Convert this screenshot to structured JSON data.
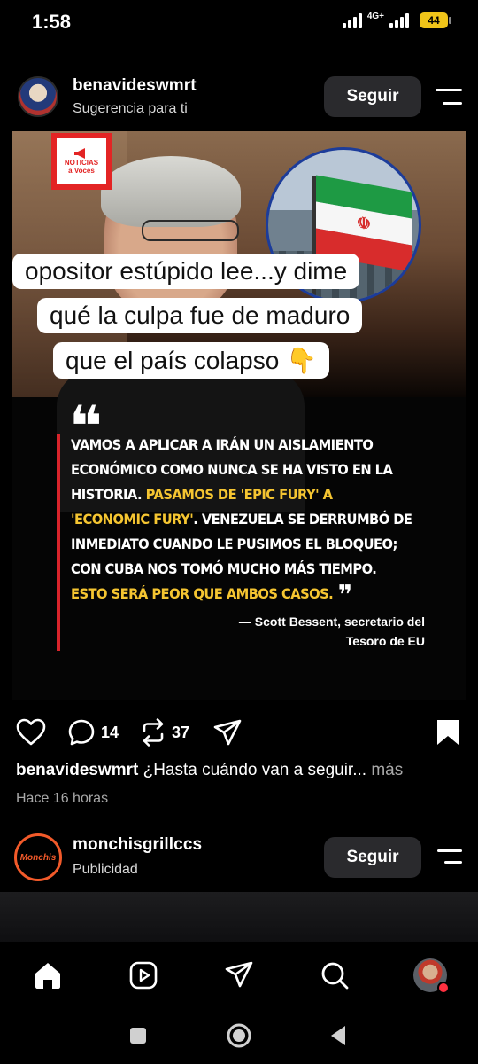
{
  "status_bar": {
    "time": "1:58",
    "network": "4G+",
    "battery": "44"
  },
  "post": {
    "username": "benavideswmrt",
    "subtitle": "Sugerencia para ti",
    "follow_label": "Seguir",
    "image": {
      "logo_lines": [
        "NOTICIAS",
        "a Voces"
      ],
      "caption_lines": [
        "opositor estúpido lee...y dime",
        "qué la culpa fue de maduro",
        "que el país colapso 👇"
      ],
      "quote_segments": [
        {
          "text": "VAMOS A APLICAR A IRÁN UN AISLAMIENTO ECONÓMICO COMO NUNCA SE HA VISTO EN LA HISTORIA. ",
          "highlight": false
        },
        {
          "text": "PASAMOS DE 'EPIC FURY' A 'ECONOMIC FURY'",
          "highlight": true
        },
        {
          "text": ". VENEZUELA SE DERRUMBÓ DE INMEDIATO CUANDO LE PUSIMOS EL BLOQUEO; CON CUBA NOS TOMÓ MUCHO MÁS TIEMPO. ",
          "highlight": false
        },
        {
          "text": "ESTO SERÁ PEOR QUE AMBOS CASOS.",
          "highlight": true
        }
      ],
      "attribution_line1": "— Scott Bessent, secretario del",
      "attribution_line2": "Tesoro de EU",
      "flag_emblem": "☫"
    },
    "actions": {
      "like_icon": "heart-icon",
      "comments_count": "14",
      "reposts_count": "37"
    },
    "caption_user": "benavideswmrt",
    "caption_text": "¿Hasta cuándo van a seguir...",
    "caption_more": "más",
    "timestamp": "Hace 16 horas"
  },
  "post2": {
    "username": "monchisgrillccs",
    "subtitle": "Publicidad",
    "follow_label": "Seguir",
    "avatar_text": "Monchis"
  },
  "colors": {
    "highlight": "#f5c531",
    "quote_bar": "#d8242b",
    "button_bg": "#2a2a2d",
    "notification": "#ff3040"
  }
}
